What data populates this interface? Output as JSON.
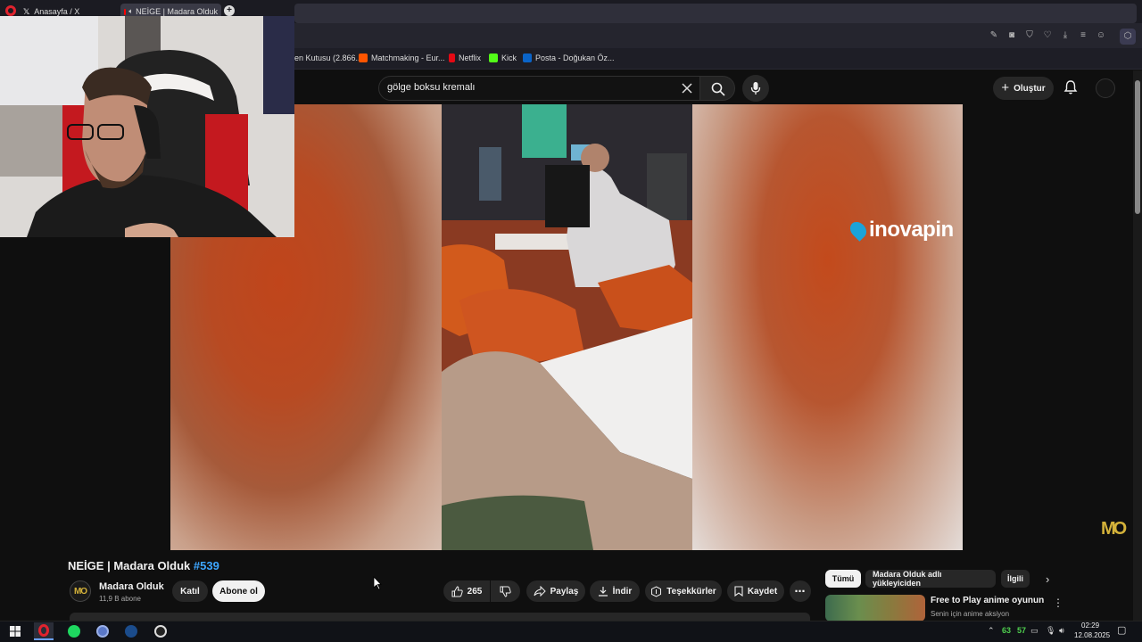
{
  "browser": {
    "tabs": [
      {
        "label": "Anasayfa / X",
        "icon": "x-logo-icon"
      },
      {
        "label": "NEİGE | Madara Olduk",
        "icon": "youtube-icon",
        "audio": true,
        "active": true
      }
    ],
    "bookmarks": [
      {
        "label": "en Kutusu (2.866...",
        "icon": "mail-icon"
      },
      {
        "label": "Matchmaking - Eur...",
        "icon": "faceit-icon"
      },
      {
        "label": "Netflix",
        "icon": "netflix-icon"
      },
      {
        "label": "Kick",
        "icon": "kick-icon"
      },
      {
        "label": "Posta - Doğukan Öz...",
        "icon": "outlook-icon"
      }
    ]
  },
  "youtube": {
    "search": {
      "value": "gölge boksu kremalı"
    },
    "create_label": "Oluştur"
  },
  "video": {
    "watermark": "inovapin",
    "channel_logo": "MO"
  },
  "meta": {
    "title_main": "NEİGE | Madara Olduk",
    "title_tag": "#539",
    "channel_name": "Madara Olduk",
    "channel_subs": "11,9 B abone",
    "join_label": "Katıl",
    "subscribe_label": "Abone ol",
    "likes": "265",
    "share_label": "Paylaş",
    "download_label": "İndir",
    "thanks_label": "Teşekkürler",
    "save_label": "Kaydet"
  },
  "recommendations": {
    "chips": [
      "Tümü",
      "Madara Olduk adlı yükleyiciden",
      "İlgili"
    ],
    "items": [
      {
        "title": "Free to Play anime oyunun",
        "subtitle": "Senin için anime aksiyon"
      }
    ]
  },
  "taskbar": {
    "tray_values": [
      "63",
      "57"
    ],
    "time": "02:29",
    "date": "12.08.2025"
  },
  "colors": {
    "youtube_bg": "#0f0f0f",
    "link_blue": "#3ea6ff",
    "chip_bg": "#272727",
    "tray_green": "#4fd04f"
  }
}
